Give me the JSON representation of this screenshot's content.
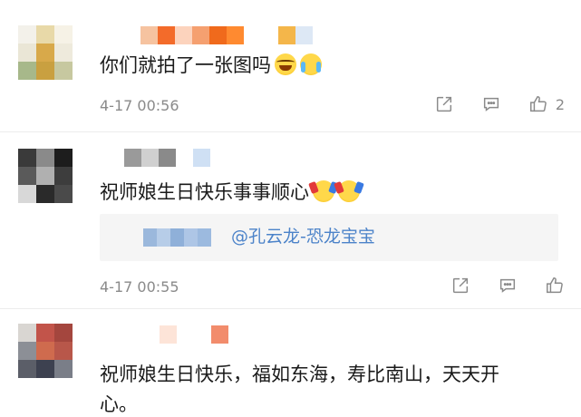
{
  "comments": [
    {
      "text": "你们就拍了一张图吗",
      "emojis": [
        "laugh-emoji",
        "cry-laugh-emoji"
      ],
      "timestamp": "4-17 00:56",
      "like_count": "2",
      "avatar_colors": [
        "#f3f1ea",
        "#e8d9a8",
        "#f6f2e6",
        "#eae6d6",
        "#d8a94a",
        "#eeeadc",
        "#a7b88a",
        "#c9a040",
        "#c7c8a0"
      ],
      "name_blur_colors": [
        "#ffffff",
        "#f6c3a0",
        "#f36b2a",
        "#fcd3bd",
        "#f5a070",
        "#f06a1c",
        "#ff8a30",
        "#ffffff",
        "#ffffff",
        "#f4b64a",
        "#dde8f5"
      ]
    },
    {
      "text": "祝师娘生日快乐事事顺心",
      "emojis": [
        "cheer-emoji",
        "cheer-emoji"
      ],
      "timestamp": "4-17 00:55",
      "reply": "@孔云龙-恐龙宝宝",
      "avatar_colors": [
        "#3a3a3a",
        "#8a8a8a",
        "#1d1d1d",
        "#5a5a5a",
        "#b0b0b0",
        "#3d3d3d",
        "#d8d8d8",
        "#2a2a2a",
        "#4a4a4a"
      ],
      "name_blur_colors": [
        "#ffffff",
        "#9a9a9a",
        "#d0d0d0",
        "#8a8a8a",
        "#ffffff",
        "#cfe0f4"
      ],
      "reply_blur_colors": [
        "#9bb8dc",
        "#b7cde8",
        "#8fb0d9",
        "#aec6e6",
        "#9cbadf"
      ]
    },
    {
      "text_line1": "祝师娘生日快乐，福如东海，寿比南山，天天开",
      "text_line2": "心。",
      "avatar_colors": [
        "#d9d6d2",
        "#c2544a",
        "#a4463e",
        "#8c8f96",
        "#cf6b4e",
        "#b8574a",
        "#5b5e68",
        "#3d4150",
        "#7a7e88"
      ],
      "name_blur_colors": [
        "#fde4d8",
        "#ffffff",
        "#ffffff",
        "#f28c6c"
      ]
    }
  ]
}
